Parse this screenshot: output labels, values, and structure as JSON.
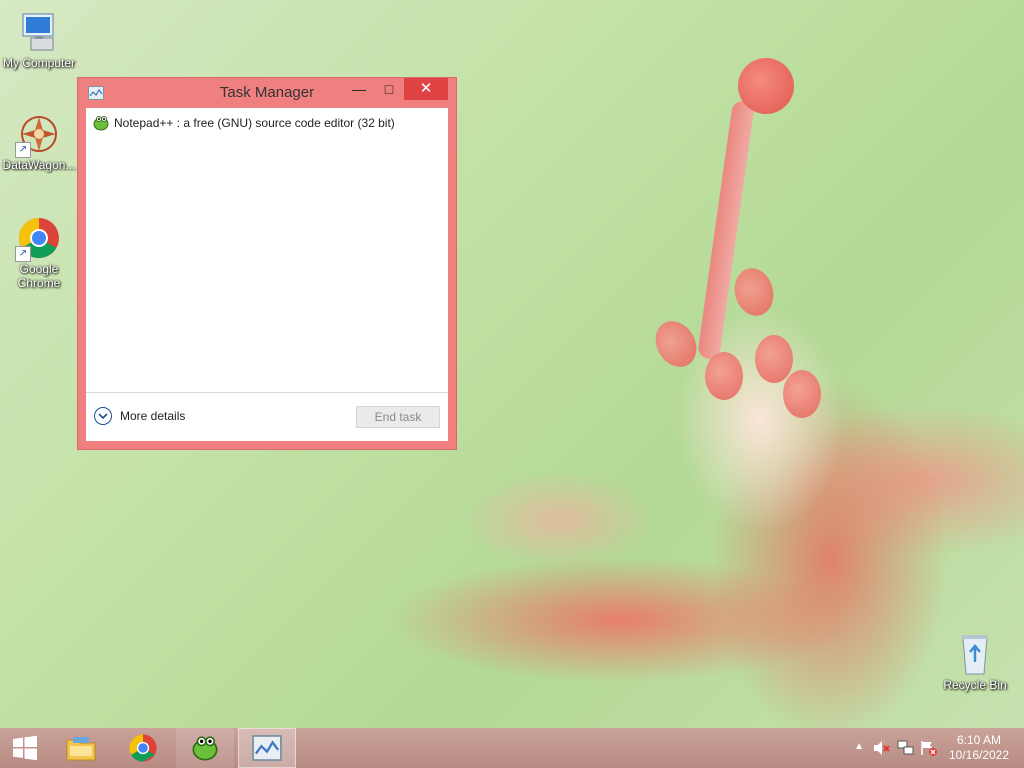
{
  "desktop": {
    "icons": [
      {
        "label": "My Computer",
        "icon": "computer-icon"
      },
      {
        "label": "DataWagon...",
        "icon": "datawagon-icon"
      },
      {
        "label_line1": "Google",
        "label_line2": "Chrome",
        "icon": "chrome-icon"
      },
      {
        "label": "Recycle Bin",
        "icon": "recycle-bin-icon"
      }
    ]
  },
  "task_manager": {
    "title": "Task Manager",
    "controls": {
      "minimize": "—",
      "maximize": "□",
      "close": "✕"
    },
    "processes": [
      {
        "name": "Notepad++ : a free (GNU) source code editor (32 bit)",
        "icon": "notepadpp-icon"
      }
    ],
    "more_details_label": "More details",
    "end_task_label": "End task"
  },
  "taskbar": {
    "items": [
      {
        "name": "start-button",
        "icon": "windows-logo-icon"
      },
      {
        "name": "file-explorer",
        "icon": "folder-icon"
      },
      {
        "name": "chrome",
        "icon": "chrome-icon"
      },
      {
        "name": "notepadpp",
        "icon": "notepadpp-icon"
      },
      {
        "name": "task-manager",
        "icon": "task-manager-icon",
        "active": true
      }
    ],
    "tray_icons": [
      "chevron-up-icon",
      "speaker-muted-icon",
      "network-icon",
      "flag-alert-icon"
    ],
    "time": "6:10 AM",
    "date": "10/16/2022"
  },
  "colors": {
    "window_frame": "#f08080",
    "close_button": "#e04343",
    "taskbar": "#b78b82"
  }
}
